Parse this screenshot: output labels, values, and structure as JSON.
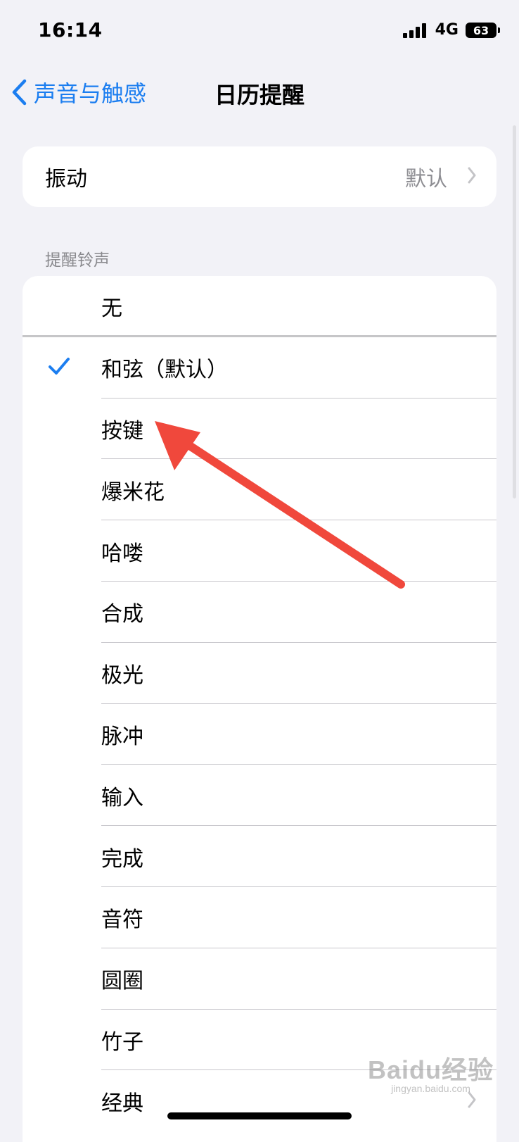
{
  "status_bar": {
    "time": "16:14",
    "network": "4G",
    "battery": "63"
  },
  "nav": {
    "back_label": "声音与触感",
    "title": "日历提醒"
  },
  "vibration": {
    "label": "振动",
    "value": "默认"
  },
  "tones": {
    "header": "提醒铃声",
    "items": [
      {
        "label": "无",
        "selected": false
      },
      {
        "label": "和弦（默认）",
        "selected": true
      },
      {
        "label": "按键",
        "selected": false
      },
      {
        "label": "爆米花",
        "selected": false
      },
      {
        "label": "哈喽",
        "selected": false
      },
      {
        "label": "合成",
        "selected": false
      },
      {
        "label": "极光",
        "selected": false
      },
      {
        "label": "脉冲",
        "selected": false
      },
      {
        "label": "输入",
        "selected": false
      },
      {
        "label": "完成",
        "selected": false
      },
      {
        "label": "音符",
        "selected": false
      },
      {
        "label": "圆圈",
        "selected": false
      },
      {
        "label": "竹子",
        "selected": false
      },
      {
        "label": "经典",
        "selected": false
      }
    ]
  },
  "watermark": {
    "brand": "Baidu经验",
    "url": "jingyan.baidu.com"
  },
  "colors": {
    "accent": "#1C7EF0",
    "annotation": "#F0483C",
    "background": "#F2F2F7",
    "secondary_text": "#8E8E93"
  },
  "icons": {
    "back": "chevron-left-icon",
    "disclosure": "chevron-right-icon",
    "selected": "checkmark-icon",
    "signal": "cellular-signal-icon",
    "battery": "battery-icon"
  }
}
